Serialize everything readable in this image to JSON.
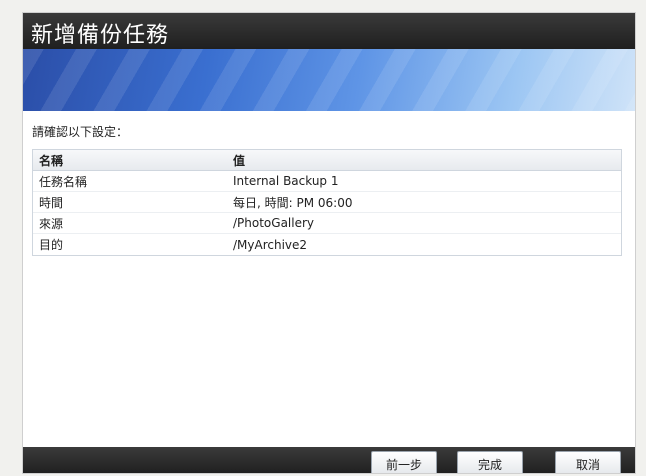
{
  "dialog": {
    "title": "新增備份任務",
    "prompt": "請確認以下設定：",
    "table": {
      "columns": [
        "名稱",
        "值"
      ],
      "rows": [
        {
          "name": "任務名稱",
          "value": "Internal Backup 1"
        },
        {
          "name": "時間",
          "value": "每日, 時間: PM 06:00"
        },
        {
          "name": "來源",
          "value": "/PhotoGallery"
        },
        {
          "name": "目的",
          "value": "/MyArchive2"
        }
      ]
    },
    "buttons": {
      "prev": "前一步",
      "finish": "完成",
      "cancel": "取消"
    }
  }
}
